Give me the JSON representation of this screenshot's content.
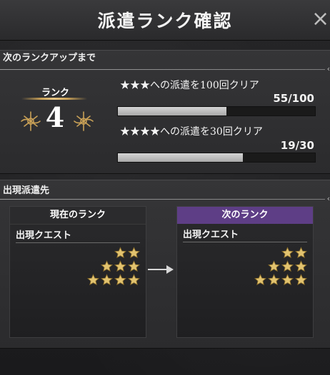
{
  "header": {
    "title": "派遣ランク確認",
    "close_label": "×"
  },
  "next_rank": {
    "section_label": "次のランクアップまで",
    "rank_label": "ランク",
    "rank_value": "4",
    "goals": [
      {
        "text": "★★★への派遣を100回クリア",
        "count": "55/100",
        "progress": 0.55
      },
      {
        "text": "★★★★への派遣を30回クリア",
        "count": "19/30",
        "progress": 0.633
      }
    ]
  },
  "dispatch": {
    "section_label": "出現派遣先",
    "current": {
      "title": "現在のランク",
      "subtitle": "出現クエスト",
      "star_rows": [
        2,
        3,
        4
      ]
    },
    "next": {
      "title": "次のランク",
      "subtitle": "出現クエスト",
      "star_rows": [
        2,
        3,
        4
      ]
    }
  },
  "colors": {
    "accent_gold": "#c9a157",
    "next_rank_purple": "#5e3e86",
    "star_gold": "#e2c36f"
  },
  "icons": {
    "close": "close-icon",
    "arrow": "arrow-right-icon",
    "crest": "ornament-crest-icon",
    "star": "star-icon"
  }
}
